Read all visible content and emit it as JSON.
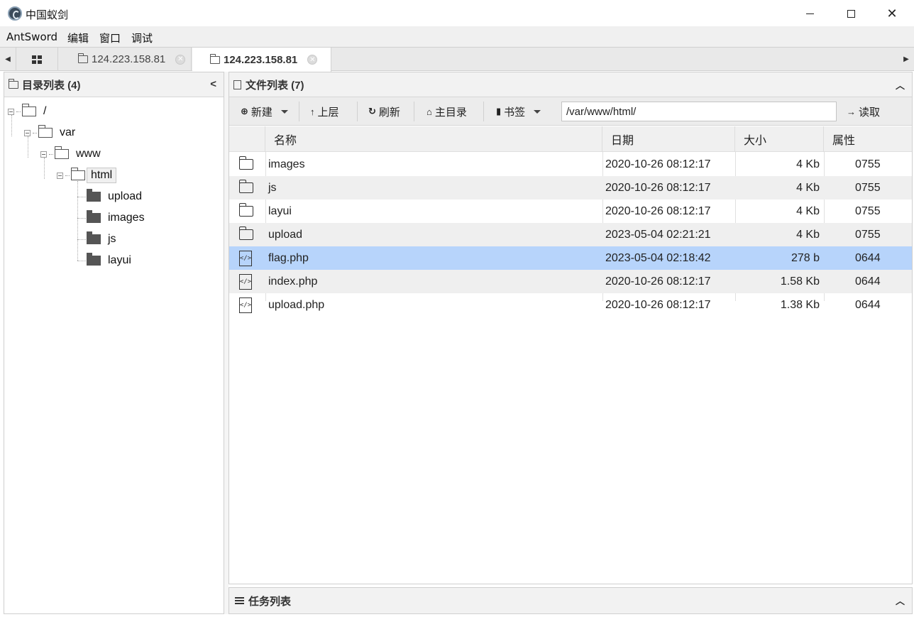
{
  "window": {
    "title": "中国蚁剑"
  },
  "menu": [
    "AntSword",
    "编辑",
    "窗口",
    "调试"
  ],
  "tabs": [
    {
      "label": "124.223.158.81",
      "active": false
    },
    {
      "label": "124.223.158.81",
      "active": true
    }
  ],
  "left_panel": {
    "title": "目录列表 (4)",
    "tree": {
      "root": "/",
      "var": "var",
      "www": "www",
      "html": "html",
      "children": [
        "upload",
        "images",
        "js",
        "layui"
      ]
    }
  },
  "right_panel": {
    "title": "文件列表 (7)",
    "toolbar": {
      "new": "新建",
      "up": "上层",
      "refresh": "刷新",
      "home": "主目录",
      "bookmark": "书签",
      "path": "/var/www/html/",
      "read": "读取"
    },
    "columns": {
      "name": "名称",
      "date": "日期",
      "size": "大小",
      "attr": "属性"
    },
    "files": [
      {
        "icon": "folder-icon",
        "name": "images",
        "date": "2020-10-26 08:12:17",
        "size": "4 Kb",
        "attr": "0755"
      },
      {
        "icon": "folder-icon",
        "name": "js",
        "date": "2020-10-26 08:12:17",
        "size": "4 Kb",
        "attr": "0755"
      },
      {
        "icon": "folder-icon",
        "name": "layui",
        "date": "2020-10-26 08:12:17",
        "size": "4 Kb",
        "attr": "0755"
      },
      {
        "icon": "folder-icon",
        "name": "upload",
        "date": "2023-05-04 02:21:21",
        "size": "4 Kb",
        "attr": "0755"
      },
      {
        "icon": "code-file-icon",
        "name": "flag.php",
        "date": "2023-05-04 02:18:42",
        "size": "278 b",
        "attr": "0644"
      },
      {
        "icon": "code-file-icon",
        "name": "index.php",
        "date": "2020-10-26 08:12:17",
        "size": "1.58 Kb",
        "attr": "0644"
      },
      {
        "icon": "code-file-icon",
        "name": "upload.php",
        "date": "2020-10-26 08:12:17",
        "size": "1.38 Kb",
        "attr": "0644"
      }
    ],
    "selected_file": "flag.php"
  },
  "task_panel": {
    "title": "任务列表"
  },
  "colors": {
    "selection": "#b7d4fb",
    "toolbar": "#ececec",
    "header": "#f2f2f2"
  }
}
